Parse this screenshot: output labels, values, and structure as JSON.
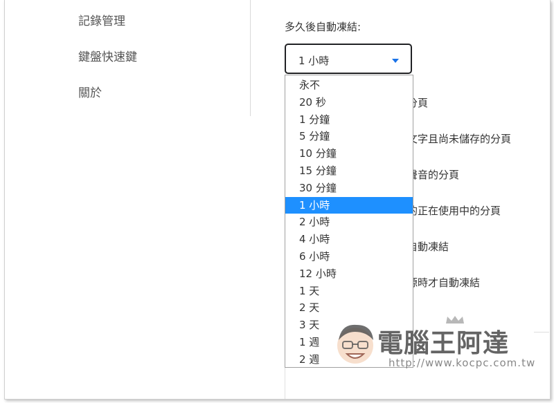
{
  "sidebar": {
    "items": [
      {
        "label": "記錄管理"
      },
      {
        "label": "鍵盤快速鍵"
      },
      {
        "label": "關於"
      }
    ]
  },
  "freeze": {
    "label": "多久後自動凍結:",
    "selected": "1 小時",
    "options": [
      "永不",
      "20 秒",
      "1 分鐘",
      "5 分鐘",
      "10 分鐘",
      "15 分鐘",
      "30 分鐘",
      "1 小時",
      "2 小時",
      "4 小時",
      "6 小時",
      "12 小時",
      "1 天",
      "2 天",
      "3 天",
      "1 週",
      "2 週"
    ],
    "selected_index": 7
  },
  "settings_partial": [
    "分頁",
    "文字且尚未儲存的分頁",
    "聲音的分頁",
    "的正在使用中的分頁",
    "自動凍結",
    "源時才自動凍結"
  ],
  "watermark": {
    "title": "電腦王阿達",
    "url": "http://www.kocpc.com.tw"
  },
  "colors": {
    "accent": "#1a73e8",
    "selection": "#1e90ff",
    "checkbox": "#d9805d"
  }
}
